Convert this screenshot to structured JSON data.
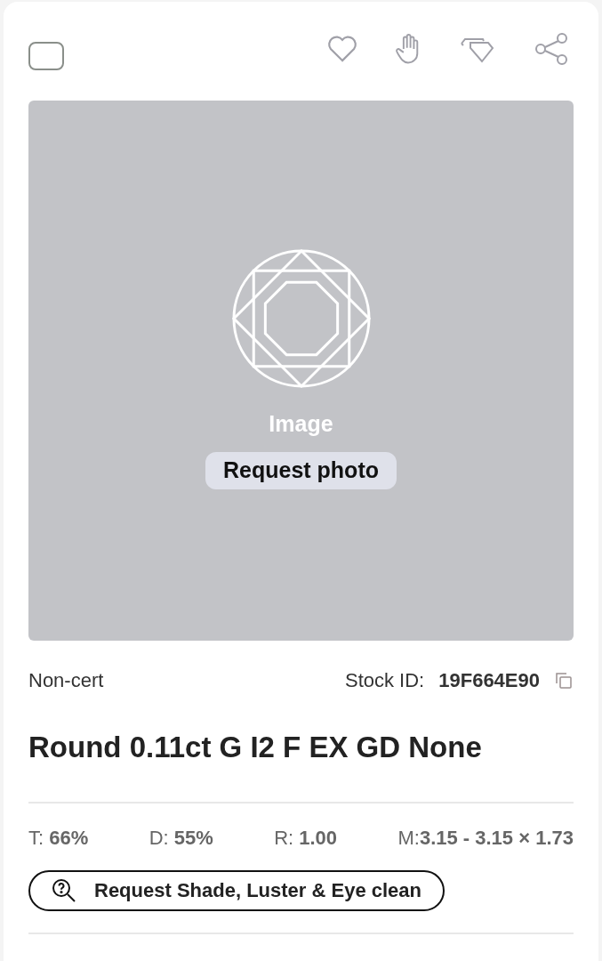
{
  "card": {
    "select": {
      "checked": false
    },
    "image": {
      "label": "Image",
      "button": "Request photo"
    },
    "cert": "Non-cert",
    "stock_label": "Stock ID:",
    "stock_id": "19F664E90",
    "title": "Round 0.11ct G I2 F EX GD None",
    "stats": [
      "T: **66%**",
      "D: **55%**",
      "R: **1.00**",
      "M:**3.15 - 3.15 × 1.73**"
    ],
    "request_button": "Request Shade, Luster & Eye clean"
  }
}
